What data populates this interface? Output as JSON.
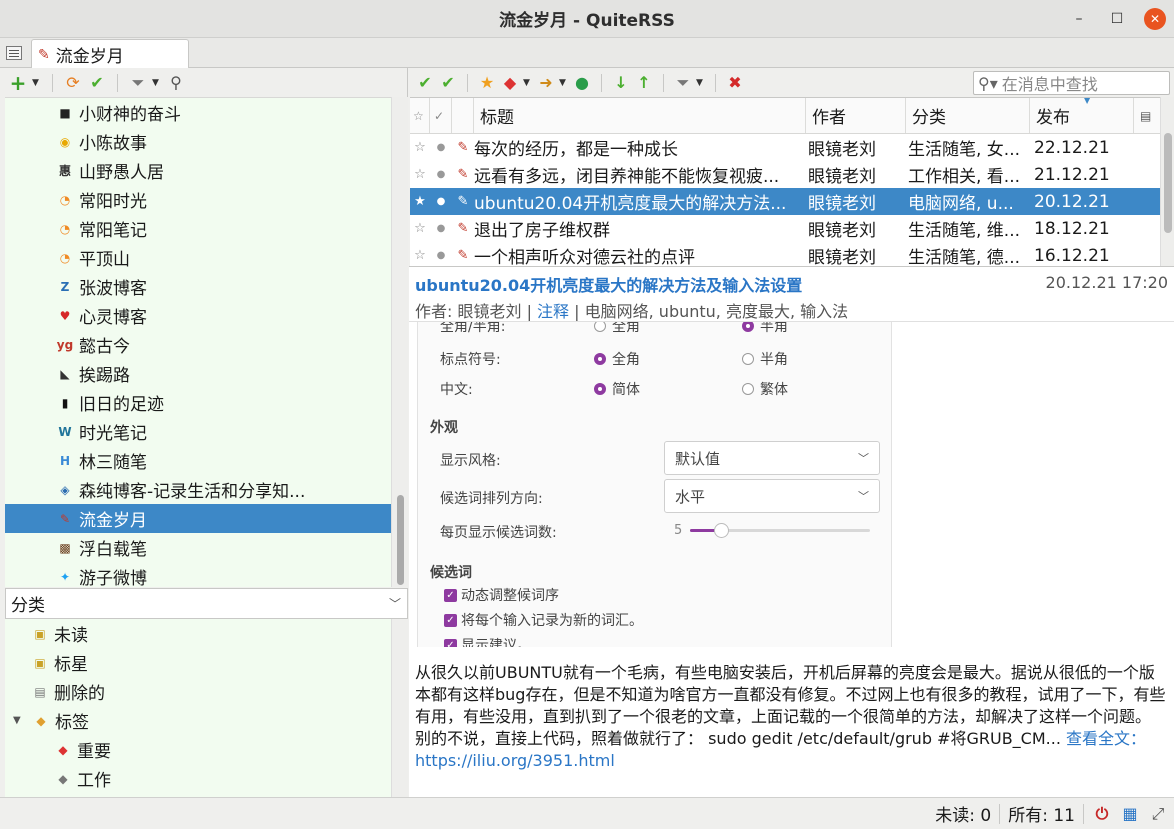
{
  "window": {
    "title": "流金岁月 - QuiteRSS",
    "minimize": "–",
    "maximize": "☐",
    "close": "✕"
  },
  "tab": {
    "label": "流金岁月"
  },
  "feeds": [
    {
      "label": "小财神的奋斗",
      "icon": "dark-square",
      "color": "#222"
    },
    {
      "label": "小陈故事",
      "icon": "coin",
      "color": "#e8a800"
    },
    {
      "label": "山野愚人居",
      "icon": "glyph",
      "color": "#333"
    },
    {
      "label": "常阳时光",
      "icon": "rss",
      "color": "#f08a24"
    },
    {
      "label": "常阳笔记",
      "icon": "rss",
      "color": "#f08a24"
    },
    {
      "label": "平顶山",
      "icon": "rss",
      "color": "#f08a24"
    },
    {
      "label": "张波博客",
      "icon": "circle-z",
      "color": "#2a6fb5"
    },
    {
      "label": "心灵博客",
      "icon": "heart",
      "color": "#d62828"
    },
    {
      "label": "懿古今",
      "icon": "yg",
      "color": "#c0392b"
    },
    {
      "label": "挨踢路",
      "icon": "road",
      "color": "#333"
    },
    {
      "label": "旧日的足迹",
      "icon": "book",
      "color": "#111"
    },
    {
      "label": "时光笔记",
      "icon": "wordpress",
      "color": "#21759b"
    },
    {
      "label": "林三随笔",
      "icon": "h",
      "color": "#3a8ad6"
    },
    {
      "label": "森纯博客-记录生活和分享知...",
      "icon": "cube",
      "color": "#2b6cb0"
    },
    {
      "label": "流金岁月",
      "icon": "quill",
      "color": "#c0392b",
      "selected": true
    },
    {
      "label": "浮白载笔",
      "icon": "photo",
      "color": "#6a3b1a"
    },
    {
      "label": "游子微博",
      "icon": "twitter",
      "color": "#1da1f2"
    }
  ],
  "categories_header": "分类",
  "categories": [
    {
      "label": "未读",
      "indent": 1,
      "icon": "folder-unread"
    },
    {
      "label": "标星",
      "indent": 1,
      "icon": "folder-star"
    },
    {
      "label": "删除的",
      "indent": 1,
      "icon": "trash"
    },
    {
      "label": "标签",
      "indent": 0,
      "icon": "tag",
      "expand": "▼"
    },
    {
      "label": "重要",
      "indent": 2,
      "icon": "tag-red"
    },
    {
      "label": "工作",
      "indent": 2,
      "icon": "tag-gray"
    }
  ],
  "search": {
    "placeholder": "在消息中查找"
  },
  "news_columns": {
    "title": "标题",
    "author": "作者",
    "category": "分类",
    "published": "发布"
  },
  "news": [
    {
      "title": "每次的经历，都是一种成长",
      "author": "眼镜老刘",
      "category": "生活随笔, 女...",
      "date": "22.12.21"
    },
    {
      "title": "远看有多远，闭目养神能不能恢复视疲...",
      "author": "眼镜老刘",
      "category": "工作相关, 看...",
      "date": "21.12.21"
    },
    {
      "title": "ubuntu20.04开机亮度最大的解决方法...",
      "author": "眼镜老刘",
      "category": "电脑网络, u...",
      "date": "20.12.21",
      "selected": true
    },
    {
      "title": "退出了房子维权群",
      "author": "眼镜老刘",
      "category": "生活随笔, 维...",
      "date": "18.12.21"
    },
    {
      "title": "一个相声听众对德云社的点评",
      "author": "眼镜老刘",
      "category": "生活随笔, 德...",
      "date": "16.12.21"
    }
  ],
  "article": {
    "title": "ubuntu20.04开机亮度最大的解决方法及输入法设置",
    "datetime": "20.12.21 17:20",
    "author_prefix": "作者: 眼镜老刘 | ",
    "comments": "注释",
    "tags": " | 电脑网络, ubuntu, 亮度最大, 输入法",
    "body": "从很久以前UBUNTU就有一个毛病，有些电脑安装后，开机后屏幕的亮度会是最大。据说从很低的一个版本都有这样bug存在，但是不知道为啥官方一直都没有修复。不过网上也有很多的教程，试用了一下，有些有用，有些没用，直到扒到了一个很老的文章，上面记载的一个很简单的方法，却解决了这样一个问题。 别的不说，直接上代码，照着做就行了： sudo gedit /etc/default/grub #将GRUB_CM...",
    "read_more": " 查看全文：https://iliu.org/3951.html",
    "screenshot": {
      "top_cut": "全角/半角:",
      "top_opt1": "全角",
      "top_opt2": "半角",
      "punct_label": "标点符号:",
      "punct_opt1": "全角",
      "punct_opt2": "半角",
      "chinese_label": "中文:",
      "chinese_opt1": "简体",
      "chinese_opt2": "繁体",
      "appearance": "外观",
      "style_label": "显示风格:",
      "style_value": "默认值",
      "orient_label": "候选词排列方向:",
      "orient_value": "水平",
      "perpage_label": "每页显示候选词数:",
      "perpage_value": "5",
      "perpage_fraction": 0.17,
      "candidates": "候选词",
      "cb1": "动态调整候词序",
      "cb2": "将每个输入记录为新的词汇。",
      "cb3": "显示建议。"
    }
  },
  "status": {
    "unread": "未读: 0",
    "total": "所有: 11"
  },
  "colors": {
    "accent": "#3d88c7",
    "feed_bg": "#f2fcf0",
    "link": "#2a76c6",
    "radio": "#8e3aa0"
  }
}
